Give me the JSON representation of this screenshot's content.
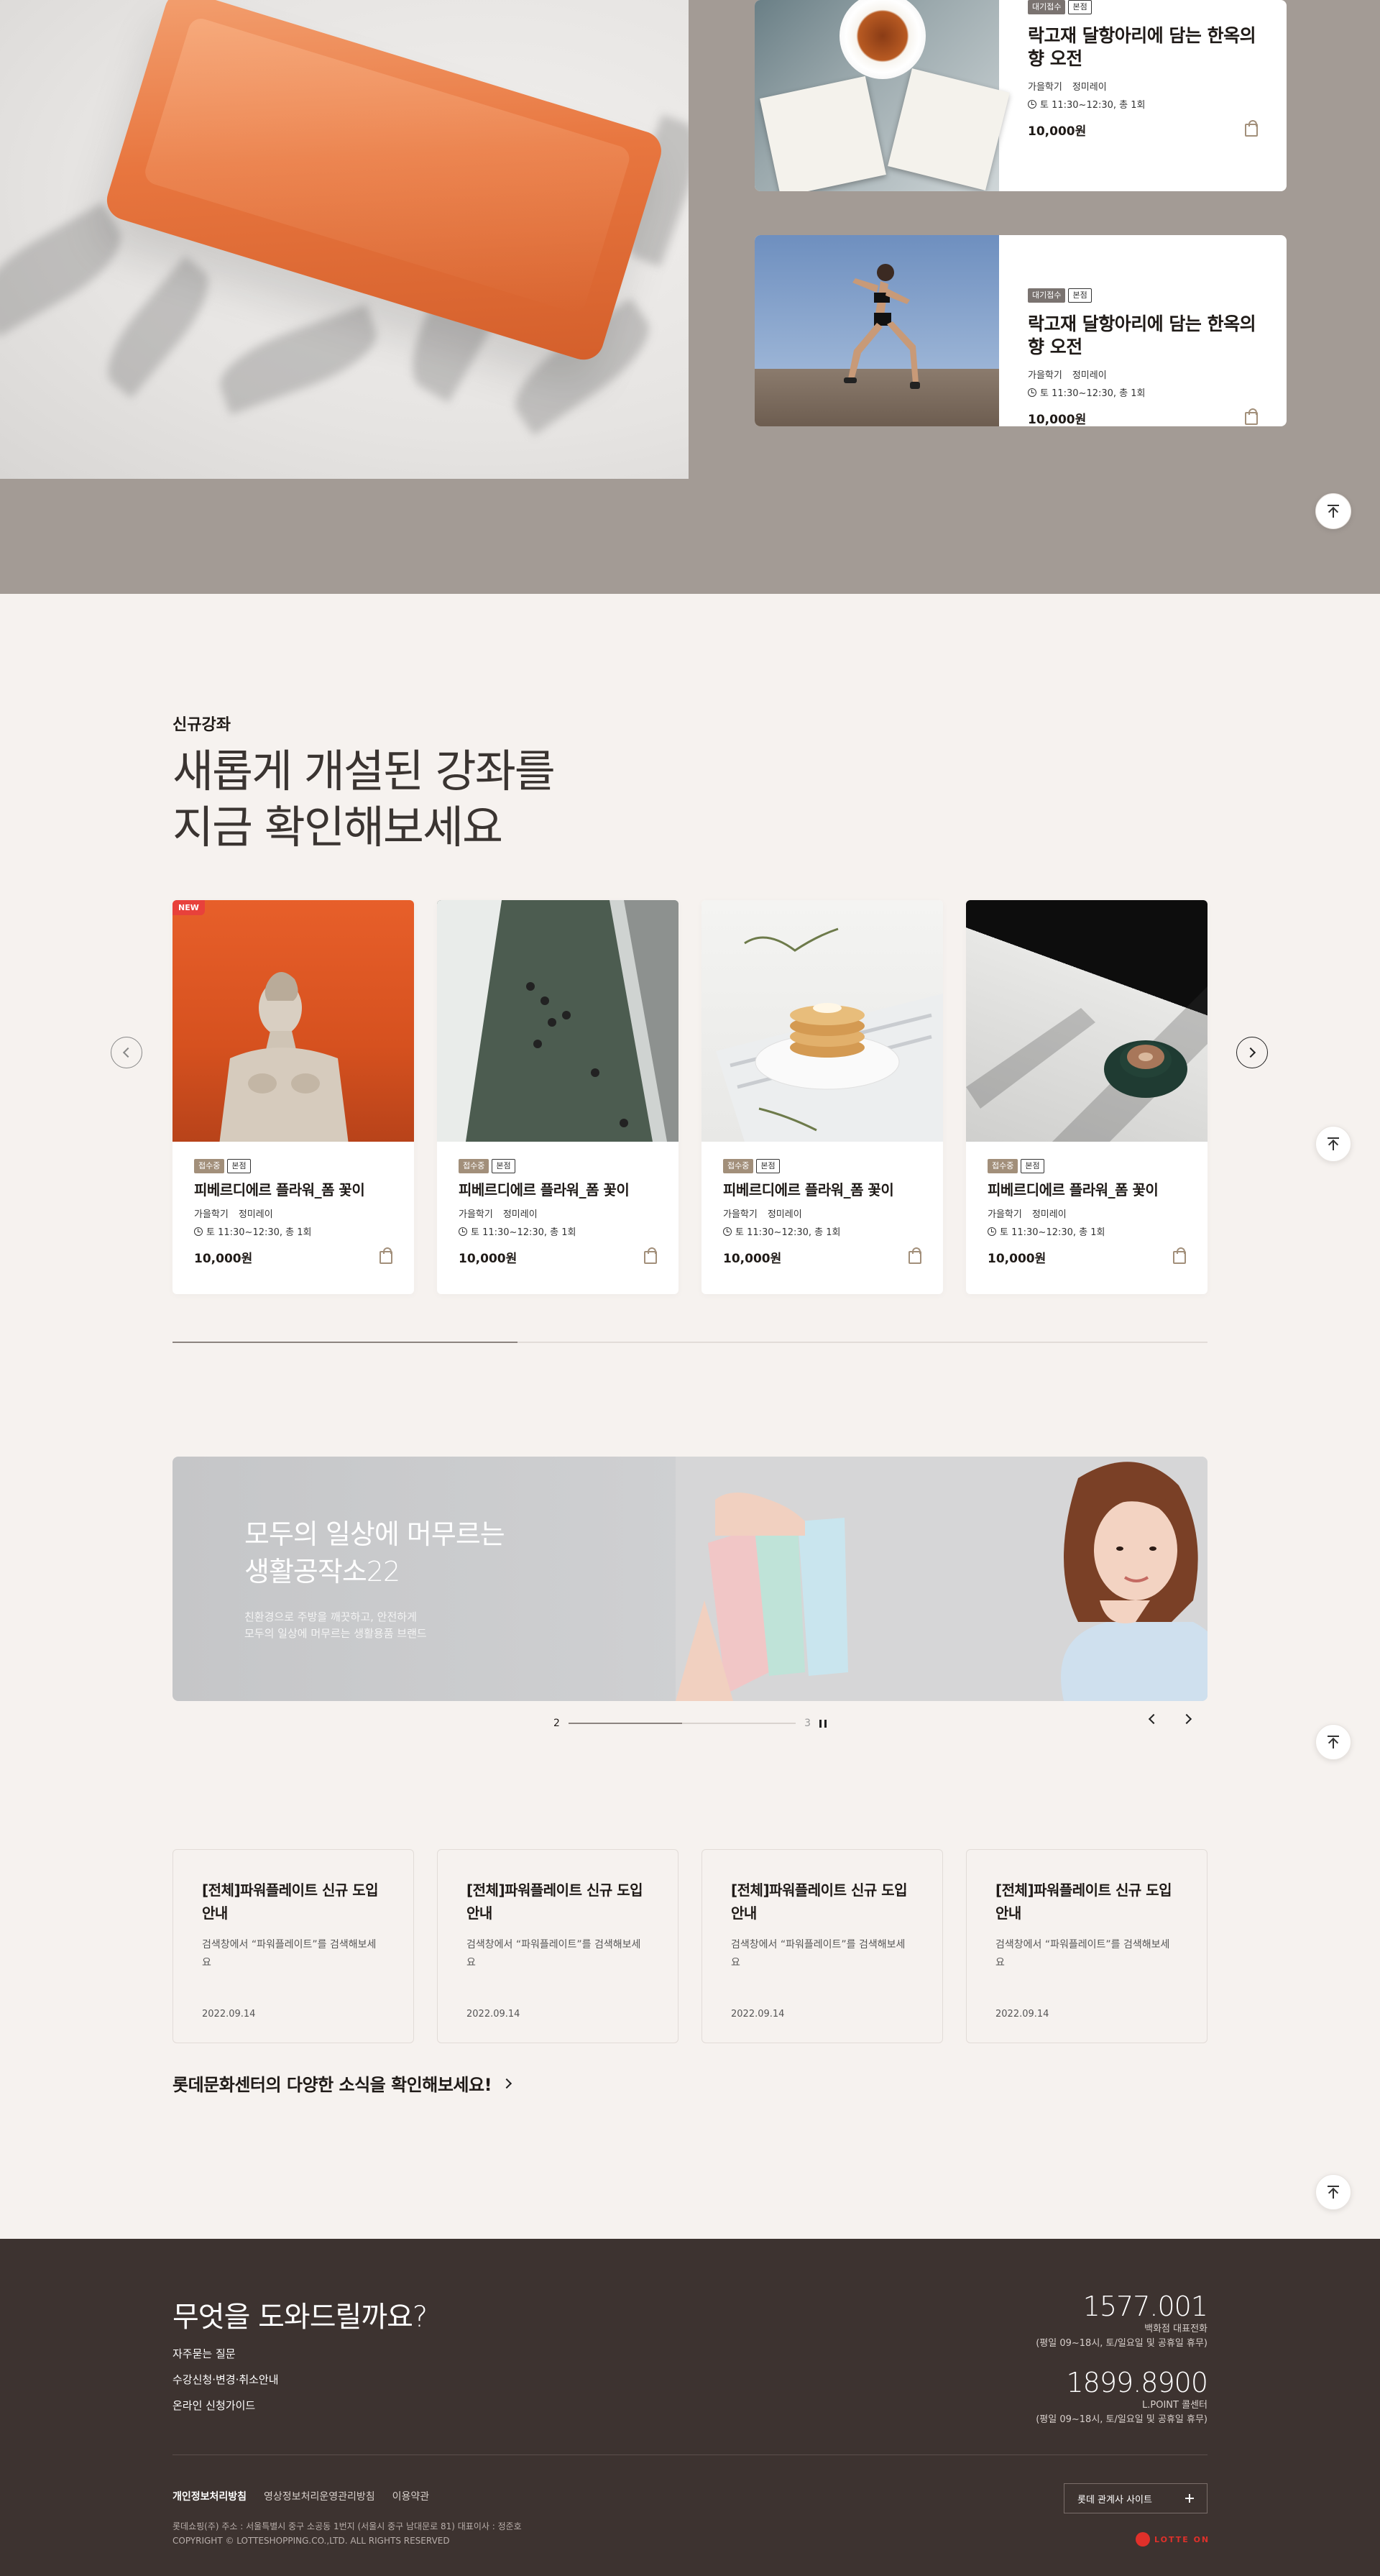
{
  "featured": {
    "cards": [
      {
        "badges": [
          "대기접수",
          "본점"
        ],
        "title": "락고재 달항아리에 담는 한옥의 향 오전",
        "term": "가을학기",
        "instructor": "정미레이",
        "time": "토 11:30~12:30, 총 1회",
        "price": "10,000원"
      },
      {
        "badges": [
          "대기접수",
          "본점"
        ],
        "title": "락고재 달항아리에 담는 한옥의 향 오전",
        "term": "가을학기",
        "instructor": "정미레이",
        "time": "토 11:30~12:30, 총 1회",
        "price": "10,000원"
      }
    ]
  },
  "new_courses": {
    "eyebrow": "신규강좌",
    "headline_line1": "새롭게 개설된 강좌를",
    "headline_line2": "지금 확인해보세요",
    "new_tag": "NEW",
    "progress": 0.333,
    "cards": [
      {
        "badges": [
          "접수중",
          "본점"
        ],
        "title": "피베르디에르 플라워_폼 꽃이",
        "term": "가을학기",
        "instructor": "정미레이",
        "time": "토 11:30~12:30, 총 1회",
        "price": "10,000원"
      },
      {
        "badges": [
          "접수중",
          "본점"
        ],
        "title": "피베르디에르 플라워_폼 꽃이",
        "term": "가을학기",
        "instructor": "정미레이",
        "time": "토 11:30~12:30, 총 1회",
        "price": "10,000원"
      },
      {
        "badges": [
          "접수중",
          "본점"
        ],
        "title": "피베르디에르 플라워_폼 꽃이",
        "term": "가을학기",
        "instructor": "정미레이",
        "time": "토 11:30~12:30, 총 1회",
        "price": "10,000원"
      },
      {
        "badges": [
          "접수중",
          "본점"
        ],
        "title": "피베르디에르 플라워_폼 꽃이",
        "term": "가을학기",
        "instructor": "정미레이",
        "time": "토 11:30~12:30, 총 1회",
        "price": "10,000원"
      }
    ]
  },
  "banner": {
    "title_line1": "모두의 일상에 머무르는",
    "title_line2": "생활공작소22",
    "sub_line1": "친환경으로 주방을 깨끗하고, 안전하게",
    "sub_line2": "모두의 일상에 머무르는 생활용품 브랜드",
    "current_page": "2",
    "total_pages": "3",
    "progress": 0.5
  },
  "notices": {
    "items": [
      {
        "title": "[전체]파워플레이트 신규 도입 안내",
        "desc": "검색창에서 “파워플레이트”를 검색해보세요",
        "date": "2022.09.14"
      },
      {
        "title": "[전체]파워플레이트 신규 도입 안내",
        "desc": "검색창에서 “파워플레이트”를 검색해보세요",
        "date": "2022.09.14"
      },
      {
        "title": "[전체]파워플레이트 신규 도입 안내",
        "desc": "검색창에서 “파워플레이트”를 검색해보세요",
        "date": "2022.09.14"
      },
      {
        "title": "[전체]파워플레이트 신규 도입 안내",
        "desc": "검색창에서 “파워플레이트”를 검색해보세요",
        "date": "2022.09.14"
      }
    ],
    "news_link": "롯데문화센터의 다양한 소식을 확인해보세요!"
  },
  "footer": {
    "help_title": "무엇을 도와드릴까요?",
    "help_links": [
      "자주묻는 질문",
      "수강신청·변경·취소안내",
      "온라인 신청가이드"
    ],
    "phones": [
      {
        "number": "1577.001",
        "label": "백화점 대표전화",
        "hours": "(평일 09~18시, 토/일요일 및 공휴일 휴무)"
      },
      {
        "number": "1899.8900",
        "label": "L.POINT 콜센터",
        "hours": "(평일 09~18시, 토/일요일 및 공휴일 휴무)"
      }
    ],
    "links": [
      "개인정보처리방침",
      "영상정보처리운영관리방침",
      "이용약관"
    ],
    "address": "롯데쇼핑(주) 주소 : 서울특별시 중구 소공동 1번지 (서울시 중구 남대문로 81)   대표이사 : 정준호",
    "copyright": "COPYRIGHT © LOTTESHOPPING.CO.,LTD. ALL RIGHTS RESERVED",
    "affiliate_label": "롯데 관계사 사이트",
    "logo_text": "LOTTE ON"
  }
}
